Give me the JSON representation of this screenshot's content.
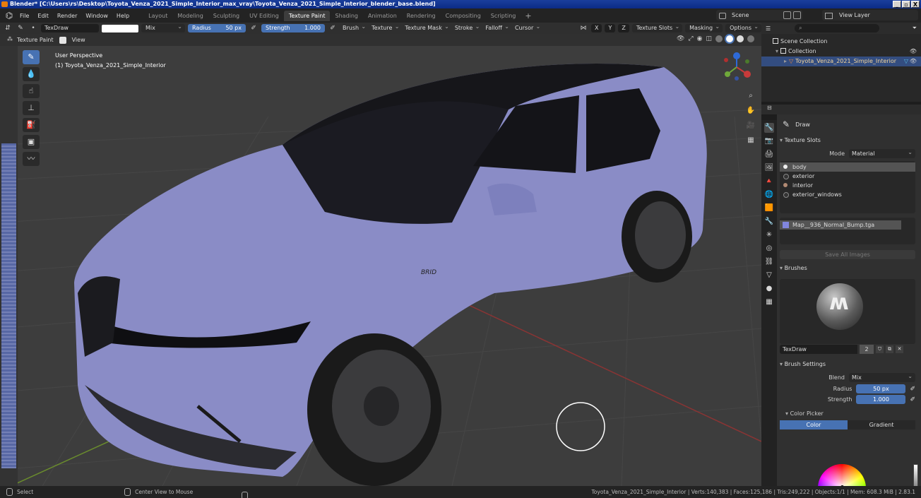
{
  "window": {
    "title": "Blender* [C:\\Users\\rs\\Desktop\\Toyota_Venza_2021_Simple_Interior_max_vray\\Toyota_Venza_2021_Simple_Interior_blender_base.blend]",
    "buttons": [
      "_",
      "▫",
      "X"
    ]
  },
  "menubar": {
    "menus": [
      "File",
      "Edit",
      "Render",
      "Window",
      "Help"
    ],
    "workspaces": [
      "Layout",
      "Modeling",
      "Sculpting",
      "UV Editing",
      "Texture Paint",
      "Shading",
      "Animation",
      "Rendering",
      "Compositing",
      "Scripting"
    ],
    "active_workspace": "Texture Paint",
    "add_tab": "+",
    "scene": "Scene",
    "view_layer": "View Layer"
  },
  "tool_header": {
    "brush_name": "TexDraw",
    "blend": "Mix",
    "radius_label": "Radius",
    "radius_value": "50 px",
    "strength_label": "Strength",
    "strength_value": "1.000",
    "menus": [
      "Brush",
      "Texture",
      "Texture Mask",
      "Stroke",
      "Falloff",
      "Cursor"
    ],
    "axes": [
      "X",
      "Y",
      "Z"
    ],
    "right_menus": [
      "Texture Slots",
      "Masking",
      "Options"
    ]
  },
  "viewport_header": {
    "mode": "Texture Paint",
    "view_menu": "View"
  },
  "viewport": {
    "perspective": "User Perspective",
    "object_label": "(1) Toyota_Venza_2021_Simple_Interior",
    "tools": [
      "draw",
      "soften",
      "smear",
      "clone",
      "fill",
      "mask",
      "annotate"
    ],
    "badge_text": "BRID",
    "car_color": "#8a8cc6"
  },
  "outliner": {
    "search_placeholder": "⌕",
    "scene_collection": "Scene Collection",
    "collection": "Collection",
    "object": "Toyota_Venza_2021_Simple_Interior"
  },
  "properties": {
    "tool_name": "Draw",
    "texture_slots_title": "Texture Slots",
    "mode_label": "Mode",
    "mode_value": "Material",
    "slots": [
      "body",
      "exterior",
      "interior",
      "exterior_windows"
    ],
    "image": "Map__936_Normal_Bump.tga",
    "save_all": "Save All Images",
    "brushes_title": "Brushes",
    "brush_name": "TexDraw",
    "brush_users": "2",
    "brush_settings_title": "Brush Settings",
    "blend_label": "Blend",
    "blend_value": "Mix",
    "radius_label": "Radius",
    "radius_value": "50 px",
    "strength_label": "Strength",
    "strength_value": "1.000",
    "color_picker_title": "Color Picker",
    "color_tab": "Color",
    "gradient_tab": "Gradient"
  },
  "statusbar": {
    "select": "Select",
    "center_view": "Center View to Mouse",
    "stats": "Toyota_Venza_2021_Simple_Interior | Verts:140,383 | Faces:125,186 | Tris:249,222 | Objects:1/1 | Mem: 608.3 MiB | 2.83.1"
  }
}
